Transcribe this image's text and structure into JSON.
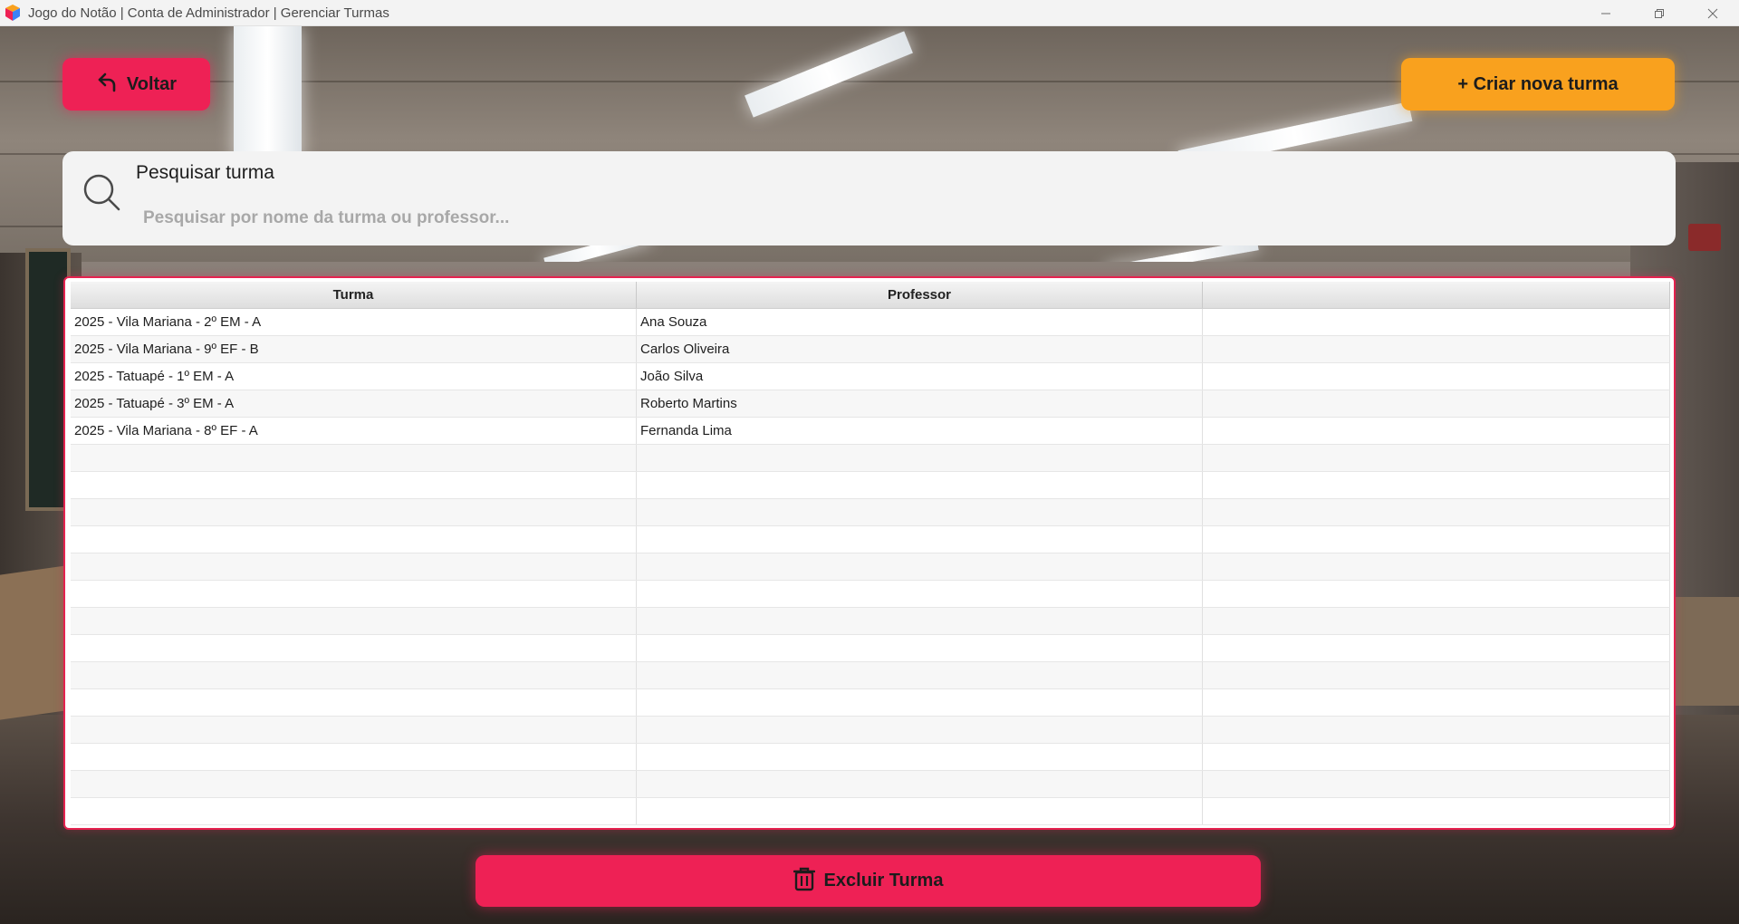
{
  "window": {
    "title": "Jogo do Notão | Conta de Administrador | Gerenciar Turmas",
    "minimize_icon": "minimize-icon",
    "maximize_icon": "restore-icon",
    "close_icon": "close-icon"
  },
  "toolbar": {
    "back_label": "Voltar",
    "back_icon": "undo-arrow-icon",
    "create_label": "+ Criar nova turma"
  },
  "search": {
    "label": "Pesquisar turma",
    "placeholder": "Pesquisar por nome da turma ou professor...",
    "value": "",
    "icon": "search-icon"
  },
  "table": {
    "columns": [
      "Turma",
      "Professor",
      ""
    ],
    "rows": [
      [
        "2025 - Vila Mariana - 2º EM - A",
        "Ana Souza",
        ""
      ],
      [
        "2025 - Vila Mariana - 9º EF - B",
        "Carlos Oliveira",
        ""
      ],
      [
        "2025 - Tatuapé - 1º EM - A",
        "João Silva",
        ""
      ],
      [
        "2025 - Tatuapé - 3º EM - A",
        "Roberto Martins",
        ""
      ],
      [
        "2025 - Vila Mariana - 8º EF - A",
        "Fernanda Lima",
        ""
      ],
      [
        "",
        "",
        ""
      ],
      [
        "",
        "",
        ""
      ],
      [
        "",
        "",
        ""
      ],
      [
        "",
        "",
        ""
      ],
      [
        "",
        "",
        ""
      ],
      [
        "",
        "",
        ""
      ],
      [
        "",
        "",
        ""
      ],
      [
        "",
        "",
        ""
      ],
      [
        "",
        "",
        ""
      ],
      [
        "",
        "",
        ""
      ],
      [
        "",
        "",
        ""
      ],
      [
        "",
        "",
        ""
      ],
      [
        "",
        "",
        ""
      ],
      [
        "",
        "",
        ""
      ]
    ]
  },
  "footer": {
    "delete_label": "Excluir Turma",
    "delete_icon": "trash-icon"
  },
  "colors": {
    "primary_pink": "#ee2155",
    "accent_orange": "#f9a11e",
    "panel_bg": "#f3f3f3"
  }
}
